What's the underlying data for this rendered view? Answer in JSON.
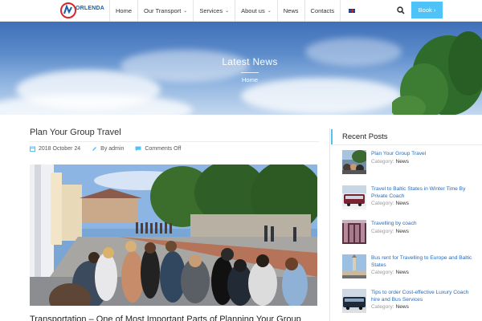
{
  "header": {
    "logo_text": "ORLENDA",
    "nav": [
      {
        "label": "Home",
        "has_dropdown": false
      },
      {
        "label": "Our Transport",
        "has_dropdown": true
      },
      {
        "label": "Services",
        "has_dropdown": true
      },
      {
        "label": "About us",
        "has_dropdown": true
      },
      {
        "label": "News",
        "has_dropdown": false
      },
      {
        "label": "Contacts",
        "has_dropdown": false
      }
    ],
    "language_icon": "uk-flag-icon",
    "search_icon": "search-icon",
    "book_label": "Book",
    "book_arrow": "›",
    "accent_color": "#4fc3f7"
  },
  "hero": {
    "title": "Latest News",
    "breadcrumb": "Home"
  },
  "post": {
    "title": "Plan Your Group Travel",
    "date": "2018 October 24",
    "author": "By admin",
    "comments": "Comments Off",
    "subtitle": "Transportation – One of Most Important Parts of Planning Your Group"
  },
  "sidebar": {
    "title": "Recent Posts",
    "category_label": "Category:",
    "posts": [
      {
        "title": "Plan Your Group Travel",
        "category": "News"
      },
      {
        "title": "Travel to Baltic States in Winter Time By Private Coach",
        "category": "News"
      },
      {
        "title": "Travelling by coach",
        "category": "News"
      },
      {
        "title": "Bus rent for Travelling to Europe and Baltic States",
        "category": "News"
      },
      {
        "title": "Tips to order Cost-effective Luxury Coach hire and Bus Services",
        "category": "News"
      }
    ]
  }
}
